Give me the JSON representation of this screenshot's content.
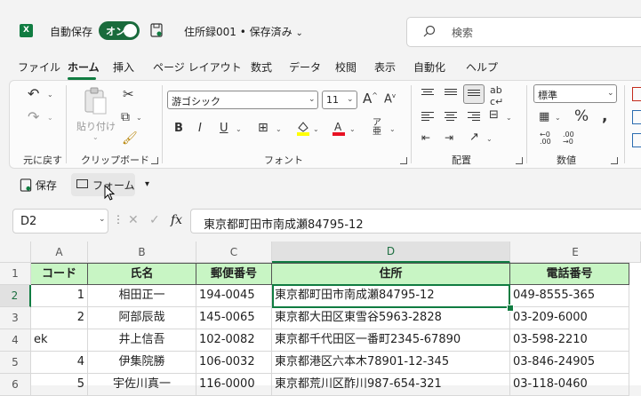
{
  "title_bar": {
    "autosave_label": "自動保存",
    "toggle_state": "オン",
    "filename": "住所録001 • 保存済み",
    "search_placeholder": "検索"
  },
  "menu": [
    "ファイル",
    "ホーム",
    "挿入",
    "ページ レイアウト",
    "数式",
    "データ",
    "校閲",
    "表示",
    "自動化",
    "ヘルプ"
  ],
  "active_tab": "ホーム",
  "ribbon": {
    "undo_group": "元に戻す",
    "clipboard_group": "クリップボード",
    "paste_label": "貼り付け",
    "font_group": "フォント",
    "font_name": "游ゴシック",
    "font_size": "11",
    "align_group": "配置",
    "number_group": "数値",
    "number_format": "標準"
  },
  "qat": {
    "save_label": "保存",
    "form_label": "フォーム"
  },
  "formula_bar": {
    "name_box": "D2",
    "fx": "fx",
    "content": "東京都町田市南成瀬84795-12"
  },
  "grid": {
    "columns": [
      "A",
      "B",
      "C",
      "D",
      "E"
    ],
    "rows": [
      "1",
      "2",
      "3",
      "4",
      "5",
      "6"
    ],
    "header": [
      "コード",
      "氏名",
      "郵便番号",
      "住所",
      "電話番号"
    ],
    "data": [
      [
        "1",
        "相田正一",
        "194-0045",
        "東京都町田市南成瀬84795-12",
        "049-8555-365"
      ],
      [
        "2",
        "阿部辰哉",
        "145-0065",
        "東京都大田区東雪谷5963-2828",
        "03-209-6000"
      ],
      [
        "ek",
        "井上信吾",
        "102-0082",
        "東京都千代田区一番町2345-67890",
        "03-598-2210"
      ],
      [
        "4",
        "伊集院勝",
        "106-0032",
        "東京都港区六本木78901-12-345",
        "03-846-24905"
      ],
      [
        "5",
        "宇佐川真一",
        "116-0000",
        "東京都荒川区酢川987-654-321",
        "03-118-0460"
      ]
    ]
  },
  "colors": {
    "accent": "#107c41",
    "header_fill": "#c8f5c4"
  }
}
